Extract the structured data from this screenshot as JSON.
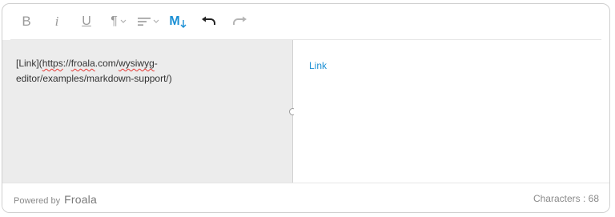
{
  "toolbar": {
    "bold_icon": "bold-icon",
    "italic_icon": "italic-icon",
    "underline_icon": "underline-icon",
    "paragraph_icon": "paragraph-format-icon",
    "align_icon": "align-icon",
    "markdown_icon": "markdown-icon",
    "undo_icon": "undo-icon",
    "redo_icon": "redo-icon",
    "bold_label": "B",
    "italic_label": "i",
    "underline_label": "U",
    "paragraph_label": "¶",
    "markdown_label": "M",
    "accent_color": "#1a8fd4"
  },
  "editor": {
    "source_prefix": "[Link](",
    "source_url_part1": "https",
    "source_url_part2": "://",
    "source_url_part3": "froala",
    "source_url_part4": ".com/",
    "source_url_part5": "wysiwyg",
    "source_url_part6": "-",
    "source_line2": "editor/examples/markdown-support/)",
    "preview_link_text": "Link"
  },
  "footer": {
    "powered_by": "Powered by",
    "brand": "Froala",
    "characters": "Characters : 68"
  }
}
